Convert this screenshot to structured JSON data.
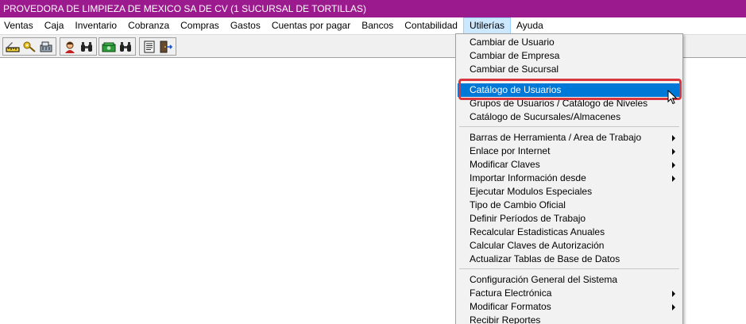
{
  "window": {
    "title": "PROVEDORA DE LIMPIEZA DE MEXICO SA DE CV  (1 SUCURSAL DE TORTILLAS)"
  },
  "menubar": {
    "items": [
      {
        "label": "Ventas"
      },
      {
        "label": "Caja"
      },
      {
        "label": "Inventario"
      },
      {
        "label": "Cobranza"
      },
      {
        "label": "Compras"
      },
      {
        "label": "Gastos"
      },
      {
        "label": "Cuentas por pagar"
      },
      {
        "label": "Bancos"
      },
      {
        "label": "Contabilidad"
      },
      {
        "label": "Utilerías",
        "open": true
      },
      {
        "label": "Ayuda"
      }
    ]
  },
  "toolbar": {
    "groups": [
      [
        "ruler-icon",
        "key-icon",
        "register-icon"
      ],
      [
        "person-icon",
        "binoculars-icon"
      ],
      [
        "cash-icon",
        "binoculars-icon"
      ],
      [
        "document-icon",
        "exit-door-icon"
      ]
    ]
  },
  "colors": {
    "title_bar": "#9b1b8e",
    "selection": "#0078d7",
    "highlight_ring": "#d9363e",
    "menu_open": "#cce8ff"
  },
  "utilerias_menu": {
    "items": [
      {
        "label": "Cambiar de Usuario",
        "submenu": false
      },
      {
        "label": "Cambiar de Empresa",
        "submenu": false
      },
      {
        "label": "Cambiar de Sucursal",
        "submenu": false
      },
      {
        "label": "Catálogo de Usuarios",
        "submenu": false,
        "selected": true
      },
      {
        "label": "Grupos de Usuarios / Catálogo de Niveles",
        "submenu": false
      },
      {
        "label": "Catálogo de Sucursales/Almacenes",
        "submenu": false
      },
      {
        "label": "Barras de Herramienta / Area de Trabajo",
        "submenu": true
      },
      {
        "label": "Enlace por Internet",
        "submenu": true
      },
      {
        "label": "Modificar Claves",
        "submenu": true
      },
      {
        "label": "Importar Información desde",
        "submenu": true
      },
      {
        "label": "Ejecutar Modulos Especiales",
        "submenu": false
      },
      {
        "label": "Tipo de Cambio Oficial",
        "submenu": false
      },
      {
        "label": "Definir Períodos de Trabajo",
        "submenu": false
      },
      {
        "label": "Recalcular Estadisticas Anuales",
        "submenu": false
      },
      {
        "label": "Calcular Claves de Autorización",
        "submenu": false
      },
      {
        "label": "Actualizar Tablas de Base de Datos",
        "submenu": false
      },
      {
        "label": "Configuración General del Sistema",
        "submenu": false
      },
      {
        "label": "Factura Electrónica",
        "submenu": true
      },
      {
        "label": "Modificar Formatos",
        "submenu": true
      },
      {
        "label": "Recibir Reportes",
        "submenu": false
      }
    ]
  }
}
